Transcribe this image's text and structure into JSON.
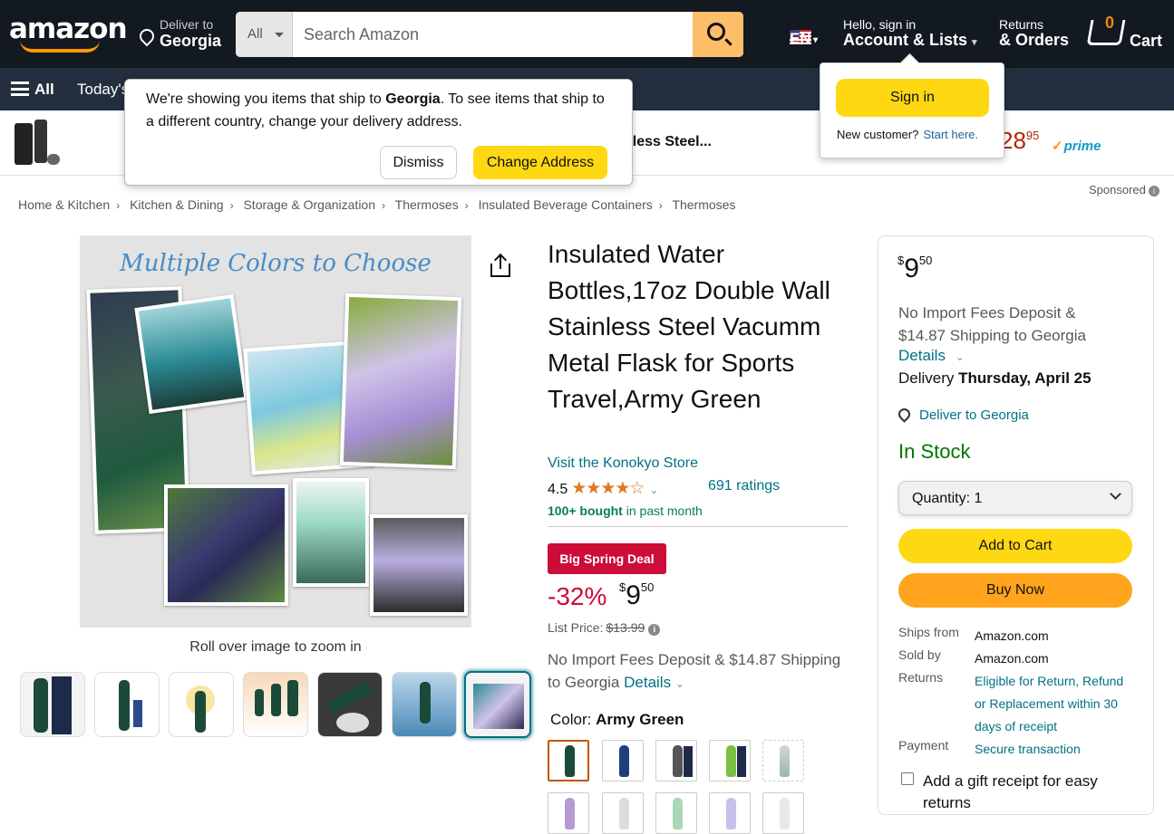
{
  "header": {
    "logo": "amazon",
    "deliver_line1": "Deliver to",
    "deliver_line2": "Georgia",
    "search_category": "All",
    "search_placeholder": "Search Amazon",
    "language": "EN",
    "account_line1": "Hello, sign in",
    "account_line2": "Account & Lists",
    "orders_line1": "Returns",
    "orders_line2": "& Orders",
    "cart_count": "0",
    "cart_label": "Cart"
  },
  "nav": {
    "all_label": "All",
    "today_label": "Today's"
  },
  "ad_strip": {
    "title": "nless Steel...",
    "price_whole": "28",
    "price_fraction": "95",
    "prime": "prime"
  },
  "address_popover": {
    "message_prefix": "We're showing you items that ship to ",
    "message_location": "Georgia",
    "message_suffix": ". To see items that ship to a different country, change your delivery address.",
    "dismiss_label": "Dismiss",
    "change_label": "Change Address"
  },
  "signin_popover": {
    "button_label": "Sign in",
    "new_customer": "New customer?",
    "start_here": "Start here."
  },
  "sponsored": "Sponsored",
  "breadcrumb": [
    "Home & Kitchen",
    "Kitchen & Dining",
    "Storage & Organization",
    "Thermoses",
    "Insulated Beverage Containers",
    "Thermoses"
  ],
  "gallery": {
    "image_heading": "Multiple Colors to Choose",
    "rollover": "Roll over image to zoom in"
  },
  "product": {
    "title": "Insulated Water Bottles,17oz Double Wall Stainless Steel Vacumm Metal Flask for Sports Travel,Army Green",
    "store_link": "Visit the Konokyo Store",
    "rating_value": "4.5",
    "stars": "★★★★☆",
    "ratings_count": "691 ratings",
    "bought_bold": "100+ bought",
    "bought_rest": " in past month",
    "deal_badge": "Big Spring Deal",
    "discount": "-32%",
    "price_symbol": "$",
    "price_whole": "9",
    "price_fraction": "50",
    "list_price_label": "List Price:",
    "list_price": "$13.99",
    "import_text": "No Import Fees Deposit & $14.87 Shipping to Georgia",
    "details_link": "Details",
    "color_label": "Color:",
    "color_value": "Army Green"
  },
  "buybox": {
    "price_symbol": "$",
    "price_whole": "9",
    "price_fraction": "50",
    "import_text": "No Import Fees Deposit & $14.87 Shipping to Georgia",
    "details_link": "Details",
    "delivery_label": "Delivery",
    "delivery_date": "Thursday, April 25",
    "deliver_to": "Deliver to Georgia",
    "stock": "In Stock",
    "quantity_label": "Quantity:",
    "quantity_value": "1",
    "add_to_cart": "Add to Cart",
    "buy_now": "Buy Now",
    "ships_from_label": "Ships from",
    "ships_from_value": "Amazon.com",
    "sold_by_label": "Sold by",
    "sold_by_value": "Amazon.com",
    "returns_label": "Returns",
    "returns_value": "Eligible for Return, Refund or Replacement within 30 days of receipt",
    "payment_label": "Payment",
    "payment_value": "Secure transaction",
    "gift_receipt": "Add a gift receipt for easy returns"
  },
  "colors": {
    "amazon_orange": "#FF9900",
    "header_bg": "#131921",
    "nav_bg": "#232F3E",
    "deal_red": "#CC0C39",
    "link_teal": "#007185",
    "stock_green": "#007600",
    "button_yellow": "#FFD814",
    "buy_now_orange": "#FFA41C"
  },
  "icons": [
    "location-pin-icon",
    "search-icon",
    "us-flag-icon",
    "cart-icon",
    "hamburger-menu-icon",
    "share-icon",
    "info-icon",
    "chevron-down-icon"
  ]
}
